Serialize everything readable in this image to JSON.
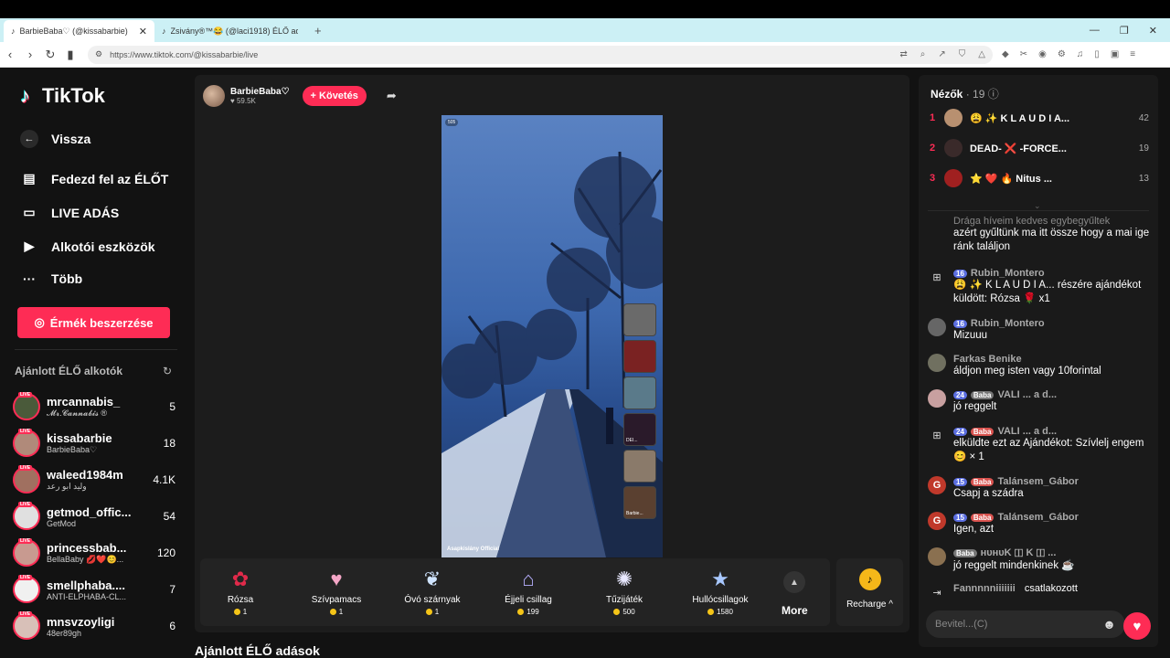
{
  "browser": {
    "tabs": [
      {
        "title": "BarbieBaba♡ (@kissabarbie)",
        "active": true
      },
      {
        "title": "Zsivány®™😂 (@laci1918) ÉLŐ adás",
        "active": false
      }
    ],
    "url": "https://www.tiktok.com/@kissabarbie/live"
  },
  "sidebar": {
    "logo": "TikTok",
    "back": "Vissza",
    "nav": [
      "Fedezd fel az ÉLŐT",
      "LIVE ADÁS",
      "Alkotói eszközök",
      "Több"
    ],
    "coins_button": "Érmék beszerzése",
    "recommended_title": "Ajánlott ÉLŐ alkotók",
    "live_badge": "LIVE",
    "creators": [
      {
        "name": "mrcannabis_",
        "sub": "𝓜𝓻.𝓒𝓪𝓷𝓷𝓪𝓫𝓲𝓼 ®",
        "count": "5"
      },
      {
        "name": "kissabarbie",
        "sub": "BarbieBaba♡",
        "count": "18"
      },
      {
        "name": "waleed1984m",
        "sub": "وليد ابو رعد",
        "count": "4.1K"
      },
      {
        "name": "getmod_offic...",
        "sub": "GetMod",
        "count": "54"
      },
      {
        "name": "princessbab...",
        "sub": "BellaBaby 💋❤️😊...",
        "count": "120"
      },
      {
        "name": "smellphaba....",
        "sub": "ANTI-ELPHABA-CL...",
        "count": "7"
      },
      {
        "name": "mnsvzoyligi",
        "sub": "48er89gh",
        "count": "6"
      }
    ]
  },
  "stream": {
    "host_name": "BarbieBaba♡",
    "host_likes": "59.5K",
    "follow_label": "+ Követés",
    "video_badge": "505",
    "video_caption": "Asapkislány Official",
    "guests": [
      "",
      "",
      "",
      "DEI...",
      "",
      "Barbie..."
    ]
  },
  "gifts": [
    {
      "name": "Rózsa",
      "price": "1",
      "icon": "rose-icon"
    },
    {
      "name": "Szívpamacs",
      "price": "1",
      "icon": "heart-puff-icon"
    },
    {
      "name": "Óvó szárnyak",
      "price": "1",
      "icon": "wings-icon"
    },
    {
      "name": "Éjjeli csillag",
      "price": "199",
      "icon": "night-star-icon"
    },
    {
      "name": "Tűzijáték",
      "price": "500",
      "icon": "firework-icon"
    },
    {
      "name": "Hullócsillagok",
      "price": "1580",
      "icon": "shooting-star-icon"
    }
  ],
  "gift_more": "More",
  "recharge": "Recharge ^",
  "recommended_live": "Ajánlott ÉLŐ adások",
  "viewers": {
    "title": "Nézők",
    "count": "· 19",
    "list": [
      {
        "rank": "1",
        "name": "😩 ✨ K L A U D I A...",
        "score": "42"
      },
      {
        "rank": "2",
        "name": "DEAD- ❌ -FORCE...",
        "score": "19"
      },
      {
        "rank": "3",
        "name": "⭐ ❤️ 🔥 Nitus ...",
        "score": "13"
      }
    ]
  },
  "chat": [
    {
      "header": "Drága híveim kedves egybegyűltek",
      "text": "azért gyűltünk ma itt össze hogy a mai ige ránk találjon",
      "level": "",
      "fan": ""
    },
    {
      "header": "Rubin_Montero",
      "text": "😩 ✨ K L A U D I A... részére ajándékot küldött: Rózsa 🌹 x1",
      "level": "16",
      "fan": ""
    },
    {
      "header": "Rubin_Montero",
      "text": "Mizuuu",
      "level": "16",
      "fan": ""
    },
    {
      "header": "Farkas Benike",
      "text": "áldjon meg isten vagy 10forintal",
      "level": "",
      "fan": ""
    },
    {
      "header": "VALI ... a d...",
      "text": "jó reggelt",
      "level": "24",
      "fan": "Baba"
    },
    {
      "header": "VALI ... a d...",
      "text": "elküldte ezt az Ajándékot: Szívlelj engem 😊 × 1",
      "level": "24",
      "fan": "Baba"
    },
    {
      "header": "Talánsem_Gábor",
      "text": "Csapj a szádra",
      "level": "15",
      "fan": "Baba"
    },
    {
      "header": "Talánsem_Gábor",
      "text": "Igen, azt",
      "level": "15",
      "fan": "Baba"
    },
    {
      "header": "ʜᴜʜᴜK 🇮 K 🇮 ...",
      "text": "jó reggelt mindenkinek ☕",
      "level": "",
      "fan": "Baba"
    },
    {
      "header": "Fannnnniiiiiii",
      "text": "csatlakozott",
      "level": "",
      "fan": ""
    }
  ],
  "chat_placeholder": "Bevitel...(C)",
  "colors": {
    "accent": "#fe2c55",
    "background": "#121212",
    "panel": "#1a1a1a"
  }
}
